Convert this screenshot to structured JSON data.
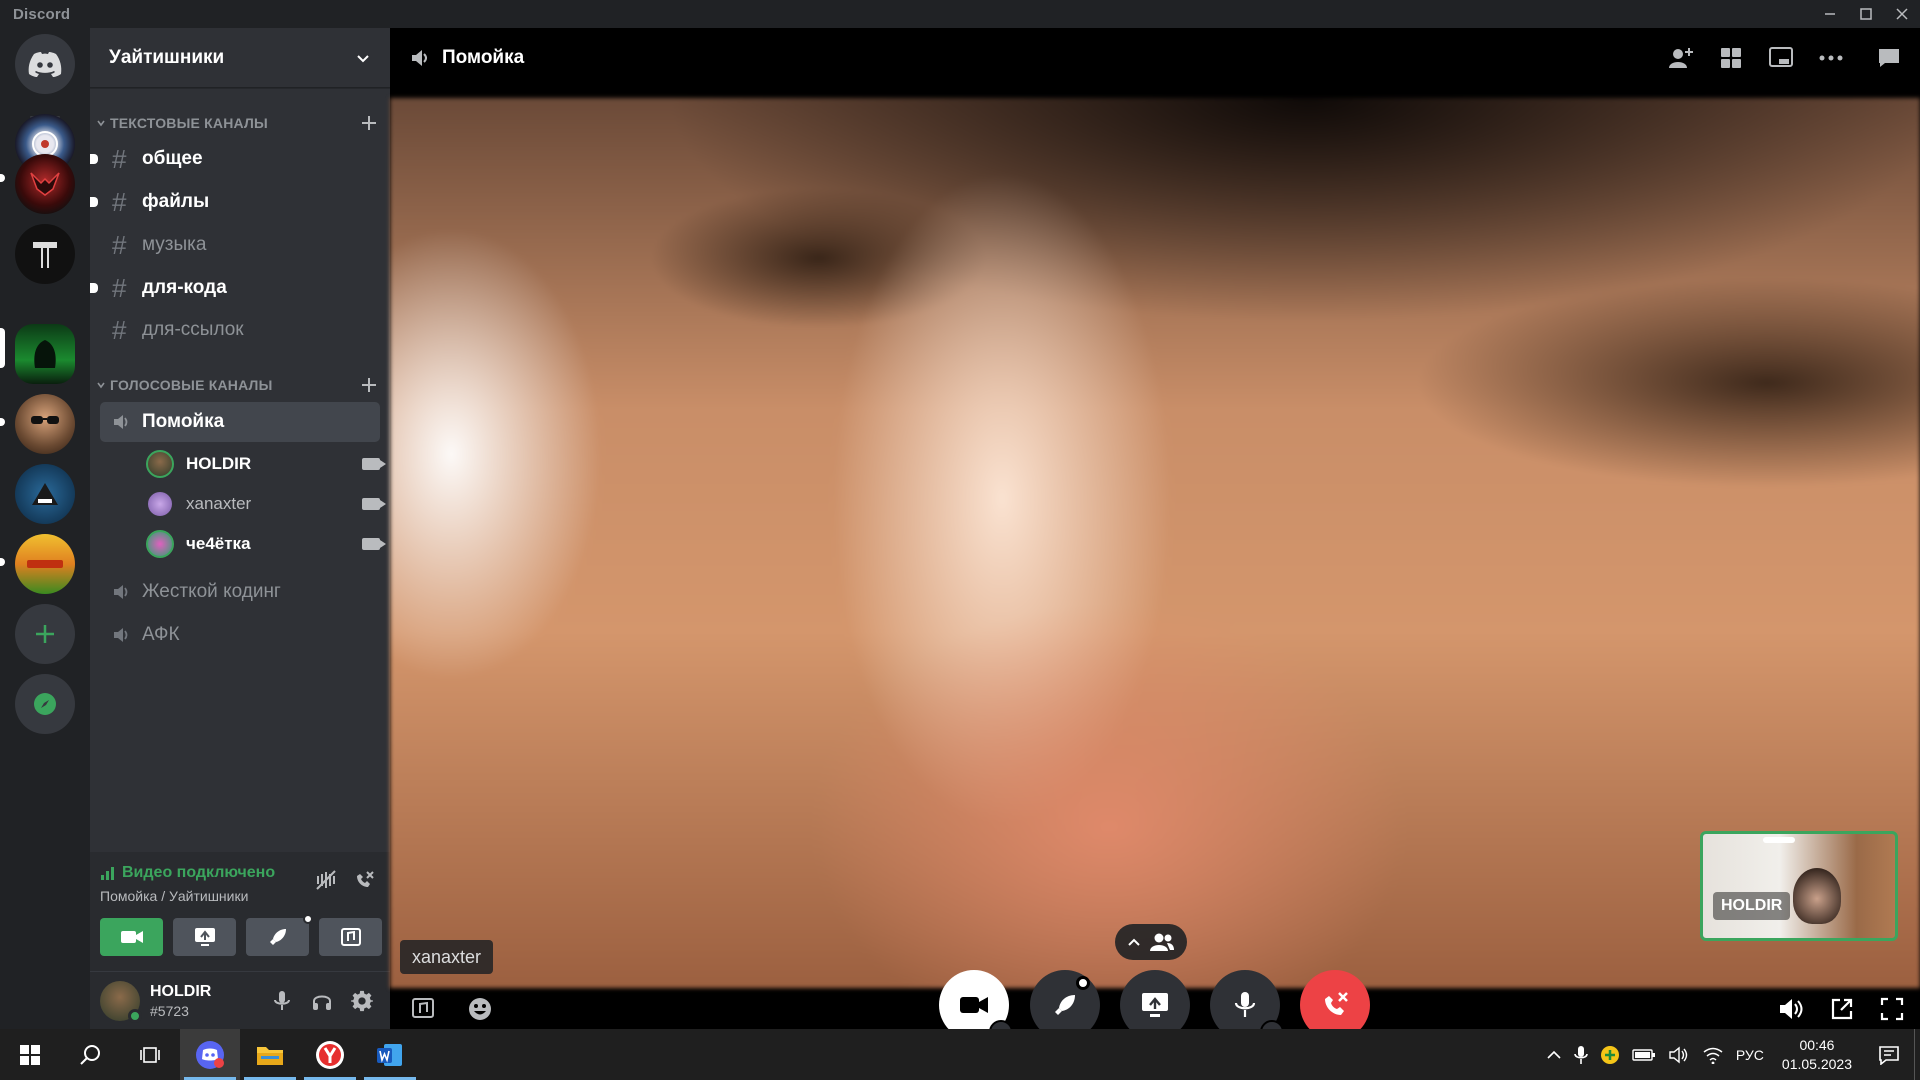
{
  "titlebar": {
    "app_name": "Discord"
  },
  "servers": [
    {
      "name": "home"
    },
    {
      "name": "server-1"
    },
    {
      "name": "server-2"
    },
    {
      "name": "server-3"
    },
    {
      "name": "server-4"
    },
    {
      "name": "server-5"
    },
    {
      "name": "server-6"
    },
    {
      "name": "server-7"
    }
  ],
  "guild": {
    "name": "Уайтишники"
  },
  "categories": {
    "text": "ТЕКСТОВЫЕ КАНАЛЫ",
    "voice": "ГОЛОСОВЫЕ КАНАЛЫ"
  },
  "text_channels": [
    {
      "name": "общее",
      "unread": true
    },
    {
      "name": "файлы",
      "unread": true
    },
    {
      "name": "музыка",
      "unread": false
    },
    {
      "name": "для-кода",
      "unread": true
    },
    {
      "name": "для-ссылок",
      "unread": false
    }
  ],
  "voice_channels": [
    {
      "name": "Помойка",
      "active": true
    },
    {
      "name": "Жесткой кодинг"
    },
    {
      "name": "АФК"
    }
  ],
  "voice_users": [
    {
      "name": "HOLDIR",
      "bold": true
    },
    {
      "name": "xanaxter",
      "bold": false
    },
    {
      "name": "че4ётка",
      "bold": true
    }
  ],
  "rtc": {
    "status": "Видео подключено",
    "location": "Помойка / Уайтишники"
  },
  "user": {
    "name": "HOLDIR",
    "tag": "#5723"
  },
  "call": {
    "channel": "Помойка",
    "speaker_tag": "xanaxter",
    "pip_name": "HOLDIR"
  },
  "taskbar": {
    "lang": "РУС",
    "time": "00:46",
    "date": "01.05.2023"
  },
  "colors": {
    "accent_green": "#3ba55d",
    "danger_red": "#ed4245",
    "blurple": "#5865f2"
  }
}
